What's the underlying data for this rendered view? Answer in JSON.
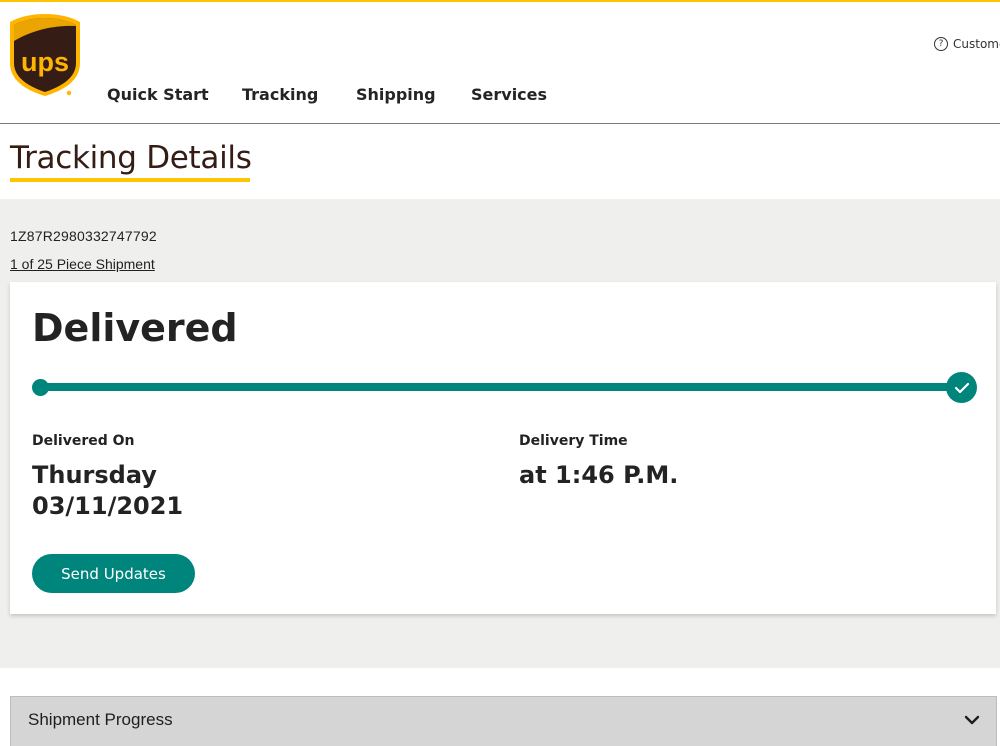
{
  "brand": {
    "logo_text": "ups",
    "colors": {
      "brown": "#351c15",
      "gold": "#ffc400",
      "teal": "#00857d",
      "band_gray": "#efefed",
      "accordion_gray": "#d5d5d5"
    }
  },
  "header": {
    "nav": [
      {
        "label": "Quick Start"
      },
      {
        "label": "Tracking"
      },
      {
        "label": "Shipping"
      },
      {
        "label": "Services"
      }
    ],
    "help_icon": "question-circle-icon",
    "help_label": "Custome"
  },
  "page": {
    "title": "Tracking Details",
    "tracking_number": "1Z87R2980332747792",
    "piece_link": "1 of 25 Piece Shipment"
  },
  "status_card": {
    "status": "Delivered",
    "progress_percent": 100,
    "progress_end_icon": "checkmark-icon",
    "delivered_on_label": "Delivered On",
    "delivered_day": "Thursday",
    "delivered_date": "03/11/2021",
    "delivery_time_label": "Delivery Time",
    "delivery_time": "at 1:46 P.M.",
    "send_updates_label": "Send Updates"
  },
  "accordion": {
    "label": "Shipment Progress",
    "icon": "chevron-down-icon"
  }
}
